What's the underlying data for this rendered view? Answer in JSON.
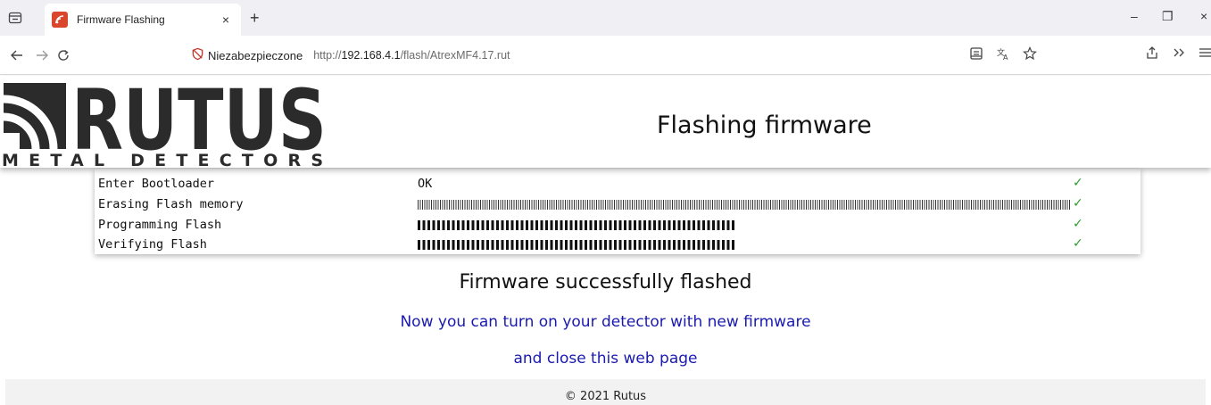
{
  "browser": {
    "tab": {
      "title": "Firmware Flashing",
      "close": "×"
    },
    "new_tab": "+",
    "window": {
      "minimize": "–",
      "restore": "❐",
      "close": "×"
    },
    "url": {
      "security_label": "Niezabezpieczone",
      "prefix": "http://",
      "host": "192.168.4.1",
      "path": "/flash/AtrexMF4.17.rut"
    },
    "icons": {
      "tab_list": "tab-list-icon",
      "back": "back-arrow-icon",
      "forward": "forward-arrow-icon",
      "reload": "reload-icon",
      "insecure": "insecure-shield-icon",
      "reader": "reader-view-icon",
      "translate": "translate-icon",
      "bookmark": "bookmark-star-icon",
      "share": "share-icon",
      "overflow": "overflow-chevrons-icon",
      "menu": "hamburger-menu-icon"
    }
  },
  "header": {
    "logo_word": "RUTUS",
    "logo_tagline": "METAL DETECTORS",
    "title": "Flashing firmware"
  },
  "steps": [
    {
      "label": "Enter Bootloader",
      "value": "OK",
      "status": "✓"
    },
    {
      "label": "Erasing Flash memory",
      "progress": 1.0,
      "status": "✓"
    },
    {
      "label": "Programming Flash",
      "progress": 1.0,
      "status": "✓"
    },
    {
      "label": "Verifying Flash",
      "progress": 1.0,
      "status": "✓"
    }
  ],
  "messages": {
    "result": "Firmware successfully flashed",
    "line1": "Now you can turn on your detector with new firmware",
    "line2": "and close this web page"
  },
  "footer": {
    "text": "© 2021 Rutus"
  },
  "colors": {
    "link_blue": "#1a1ab0",
    "check_green": "#2e9a2e",
    "logo_dark": "#2b2b2b",
    "favicon_red": "#d9462c"
  }
}
